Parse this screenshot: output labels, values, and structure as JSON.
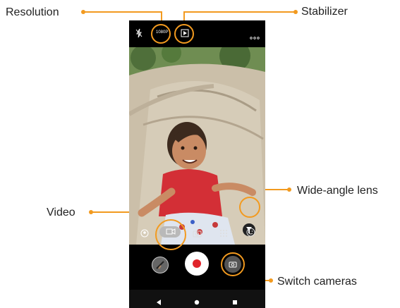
{
  "labels": {
    "resolution": "Resolution",
    "stabilizer": "Stabilizer",
    "wide_angle": "Wide-angle lens",
    "video": "Video",
    "switch_cameras": "Switch cameras"
  },
  "camera": {
    "resolution_value": "1080P"
  },
  "colors": {
    "accent": "#f29a1f",
    "record": "#e0242b"
  },
  "icons": [
    "flash-off-icon",
    "stabilizer-icon",
    "more-options-icon",
    "wide-angle-icon",
    "portrait-icon",
    "video-mode-icon",
    "photo-mode-icon",
    "grid-mode-icon",
    "face-icon",
    "gallery-icon",
    "record-button",
    "switch-camera-icon",
    "back-nav-icon",
    "home-nav-icon",
    "recent-nav-icon"
  ]
}
